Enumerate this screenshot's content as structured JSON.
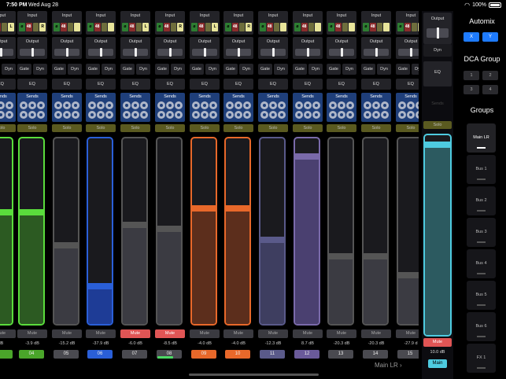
{
  "status": {
    "time": "7:50 PM",
    "date": "Wed Aug 28",
    "battery": "100%"
  },
  "strip_labels": {
    "input": "Input",
    "output": "Output",
    "gate": "Gate",
    "dyn": "Dyn",
    "eq": "EQ",
    "sends": "Sends",
    "solo": "Solo",
    "mute": "Mute"
  },
  "channels": [
    {
      "num": "",
      "db": "dB",
      "color": "#5adc3c",
      "level": 0.62,
      "mute": false,
      "fill": "#2c5a22",
      "numcolor": "#4aa52a",
      "input_btns": [
        "",
        "",
        "",
        "L"
      ]
    },
    {
      "num": "04",
      "db": "-3.9 dB",
      "color": "#5adc3c",
      "level": 0.62,
      "mute": false,
      "fill": "#2c5a22",
      "numcolor": "#4aa52a",
      "input_btns": [
        "ø",
        "48",
        "",
        "R"
      ]
    },
    {
      "num": "05",
      "db": "-15.2 dB",
      "color": "#555",
      "level": 0.44,
      "mute": false,
      "fill": "#3b3b42",
      "numcolor": "#4a4a50",
      "input_btns": [
        "ø",
        "48",
        "",
        ""
      ]
    },
    {
      "num": "06",
      "db": "-37.9 dB",
      "color": "#2a5fd8",
      "level": 0.22,
      "mute": false,
      "fill": "#1e3c96",
      "numcolor": "#2a5fd8",
      "input_btns": [
        "ø",
        "48",
        "",
        ""
      ]
    },
    {
      "num": "07",
      "db": "-6.0 dB",
      "color": "#555",
      "level": 0.55,
      "mute": true,
      "fill": "#3b3b42",
      "numcolor": "#4a4a50",
      "input_btns": [
        "ø",
        "48",
        "",
        "L"
      ]
    },
    {
      "num": "08",
      "db": "-8.5 dB",
      "color": "#555",
      "level": 0.53,
      "mute": true,
      "fill": "#3b3b42",
      "numcolor": "#4a4a50",
      "input_btns": [
        "ø",
        "48",
        "",
        "R"
      ]
    },
    {
      "num": "09",
      "db": "-4.0 dB",
      "color": "#e8682a",
      "level": 0.64,
      "mute": false,
      "fill": "#5c2e1c",
      "numcolor": "#e8682a",
      "input_btns": [
        "ø",
        "48",
        "",
        "L"
      ]
    },
    {
      "num": "10",
      "db": "-4.0 dB",
      "color": "#e8682a",
      "level": 0.64,
      "mute": false,
      "fill": "#5c2e1c",
      "numcolor": "#e8682a",
      "input_btns": [
        "ø",
        "48",
        "",
        "R"
      ]
    },
    {
      "num": "11",
      "db": "-12.3 dB",
      "color": "#5a5a8a",
      "level": 0.47,
      "mute": false,
      "fill": "#3e3e60",
      "numcolor": "#5a5a8a",
      "input_btns": [
        "ø",
        "48",
        "",
        ""
      ]
    },
    {
      "num": "12",
      "db": "8.7 dB",
      "color": "#7a6aaa",
      "level": 0.92,
      "mute": false,
      "fill": "#4a4070",
      "numcolor": "#6a5a9a",
      "input_btns": [
        "ø",
        "48",
        "",
        ""
      ]
    },
    {
      "num": "13",
      "db": "-20.3 dB",
      "color": "#555",
      "level": 0.38,
      "mute": false,
      "fill": "#3b3b42",
      "numcolor": "#4a4a50",
      "input_btns": [
        "ø",
        "48",
        "",
        ""
      ]
    },
    {
      "num": "14",
      "db": "-20.3 dB",
      "color": "#555",
      "level": 0.38,
      "mute": false,
      "fill": "#3b3b42",
      "numcolor": "#4a4a50",
      "input_btns": [
        "ø",
        "48",
        "",
        ""
      ]
    },
    {
      "num": "15",
      "db": "-27.9 d",
      "color": "#555",
      "level": 0.28,
      "mute": false,
      "fill": "#3b3b42",
      "numcolor": "#4a4a50",
      "input_btns": [
        "ø",
        "48",
        "",
        ""
      ]
    }
  ],
  "master": {
    "output": "Output",
    "dyn": "Dyn",
    "eq": "EQ",
    "sends": "Sends",
    "solo": "Solo",
    "mute": "Mute",
    "db": "10.0 dB",
    "name": "Main",
    "level": 0.97
  },
  "nav": {
    "main_lr": "Main LR"
  },
  "right": {
    "automix_title": "Automix",
    "x": "X",
    "y": "Y",
    "dca_title": "DCA Group",
    "dca": [
      "1",
      "2",
      "3",
      "4"
    ],
    "groups_title": "Groups",
    "groups": [
      "Main LR",
      "Bus 1",
      "Bus 2",
      "Bus 3",
      "Bus 4",
      "Bus 5",
      "Bus 6",
      "FX 1"
    ]
  }
}
